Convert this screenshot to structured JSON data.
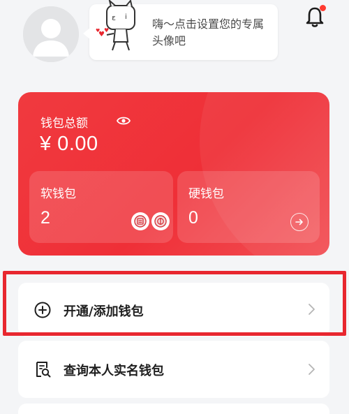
{
  "header": {
    "bubble_text": "嗨～点击设置您的专属头像吧",
    "notification_dot_color": "#ff3b30"
  },
  "wallet": {
    "total_label": "钱包总额",
    "total_amount": "¥ 0.00",
    "soft_wallet": {
      "label": "软钱包",
      "count": "2"
    },
    "hard_wallet": {
      "label": "硬钱包",
      "count": "0"
    },
    "accent_color": "#ef2f37"
  },
  "menu": {
    "items": [
      {
        "label": "开通/添加钱包",
        "icon": "plus-circle-icon"
      },
      {
        "label": "查询本人实名钱包",
        "icon": "search-document-icon"
      }
    ]
  },
  "highlight_color": "#e8272f"
}
